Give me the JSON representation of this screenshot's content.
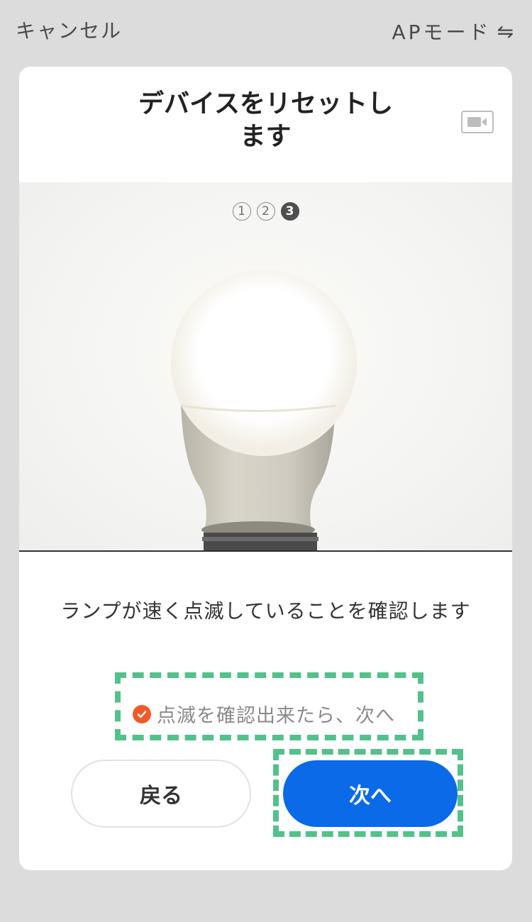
{
  "topbar": {
    "cancel_label": "キャンセル",
    "mode_label": "APモード",
    "mode_icon": "swap-arrows-icon"
  },
  "card": {
    "title_line1": "デバイスをリセットし",
    "title_line2": "ます",
    "video_icon": "video-camera-icon"
  },
  "steps": {
    "items": [
      "1",
      "2",
      "3"
    ],
    "active_index": 2
  },
  "photo": {
    "subject": "light-bulb"
  },
  "instruction_text": "ランプが速く点滅していることを確認します",
  "confirm": {
    "label": "点滅を確認出来たら、次へ",
    "checked": true,
    "icon": "check-circle-icon"
  },
  "buttons": {
    "back_label": "戻る",
    "next_label": "次へ"
  },
  "colors": {
    "background": "#dcdcdc",
    "card": "#ffffff",
    "primary": "#0a6ae8",
    "check": "#f2592a",
    "highlight_dash": "#54c08c"
  }
}
